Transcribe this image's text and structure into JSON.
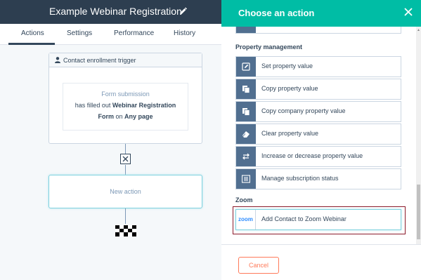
{
  "workflow": {
    "title": "Example Webinar Registration"
  },
  "tabs": [
    "Actions",
    "Settings",
    "Performance",
    "History"
  ],
  "trigger": {
    "header": "Contact enrollment trigger",
    "source": "Form submission",
    "line1_prefix": "has filled out ",
    "form_name_part1": "Webinar Registration",
    "form_name_part2": "Form",
    "on_text": " on ",
    "page": "Any page"
  },
  "new_action_label": "New action",
  "panel": {
    "title": "Choose an action",
    "sections": [
      {
        "label": "Property management",
        "actions": [
          {
            "label": "Set property value",
            "icon": "pencil-icon"
          },
          {
            "label": "Copy property value",
            "icon": "copy-icon"
          },
          {
            "label": "Copy company property value",
            "icon": "copy-icon"
          },
          {
            "label": "Clear property value",
            "icon": "eraser-icon"
          },
          {
            "label": "Increase or decrease property value",
            "icon": "swap-arrows-icon"
          },
          {
            "label": "Manage subscription status",
            "icon": "list-icon"
          }
        ]
      },
      {
        "label": "Zoom",
        "actions": [
          {
            "label": "Add Contact to Zoom Webinar",
            "icon": "zoom",
            "logo_text": "zoom"
          }
        ]
      }
    ],
    "cancel_label": "Cancel"
  },
  "colors": {
    "header_dark": "#2d3e50",
    "panel_header": "#00bda5",
    "icon_tile": "#516f90",
    "cancel_accent": "#ff7a59",
    "highlight_border": "#8b1a2b"
  }
}
